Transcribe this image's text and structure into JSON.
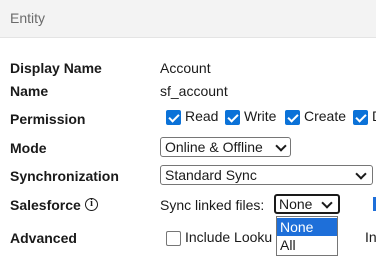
{
  "header": {
    "title": "Entity"
  },
  "fields": {
    "display_name": {
      "label": "Display Name",
      "value": "Account"
    },
    "name": {
      "label": "Name",
      "value": "sf_account"
    },
    "permission": {
      "label": "Permission",
      "options": [
        {
          "label": "Read",
          "checked": true
        },
        {
          "label": "Write",
          "checked": true
        },
        {
          "label": "Create",
          "checked": true
        },
        {
          "label": "D",
          "checked": true
        }
      ]
    },
    "mode": {
      "label": "Mode",
      "selected": "Online & Offline"
    },
    "synchronization": {
      "label": "Synchronization",
      "selected": "Standard Sync"
    },
    "salesforce": {
      "label": "Salesforce",
      "icon": "info-icon",
      "sync_label": "Sync linked files:",
      "selected": "None",
      "dropdown_options": [
        "None",
        "All"
      ]
    },
    "advanced": {
      "label": "Advanced",
      "checkbox_label": "Include Looku",
      "checked": false,
      "trailing_text": "In"
    }
  },
  "colors": {
    "accent": "#0b72d8",
    "selected_option": "#1e6fd9",
    "header_bg": "#f3f3f3"
  }
}
